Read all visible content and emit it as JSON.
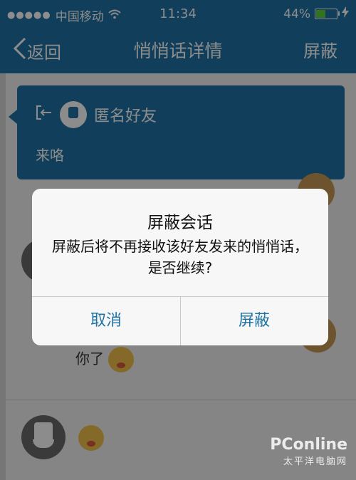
{
  "status": {
    "carrier": "中国移动",
    "time": "11:34",
    "battery_text": "44%",
    "battery_level": 0.44
  },
  "nav": {
    "back_label": "返回",
    "title": "悄悄话详情",
    "action_label": "屏蔽"
  },
  "card": {
    "sender": "匿名好友",
    "message": "来咯"
  },
  "conversation": {
    "line1": "你了"
  },
  "dialog": {
    "title": "屏蔽会话",
    "body": "屏蔽后将不再接收该好友发来的悄悄话，是否继续?",
    "cancel": "取消",
    "confirm": "屏蔽"
  },
  "watermark": {
    "main": "PConline",
    "sub": "太平洋电脑网"
  },
  "colors": {
    "accent": "#1f74a6"
  }
}
